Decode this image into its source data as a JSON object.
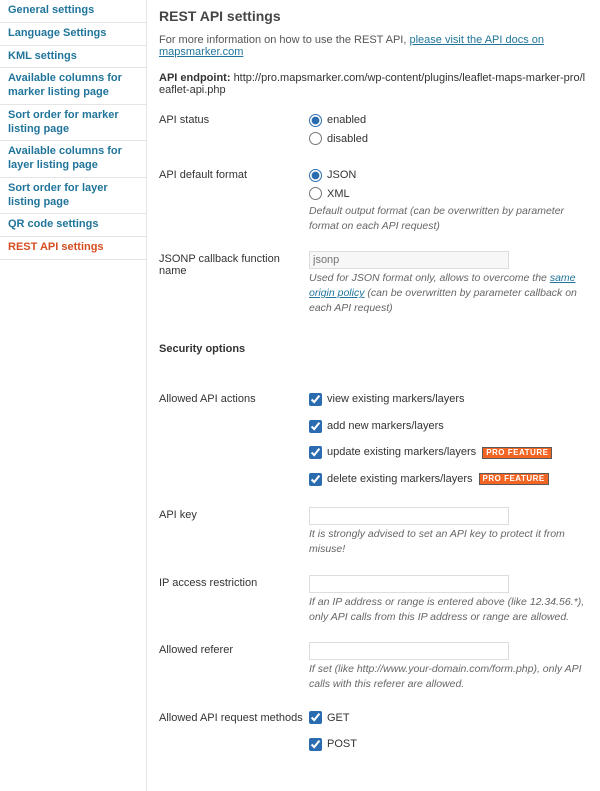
{
  "sidebar": {
    "items": [
      {
        "label": "General settings"
      },
      {
        "label": "Language Settings"
      },
      {
        "label": "KML settings"
      },
      {
        "label": "Available columns for marker listing page"
      },
      {
        "label": "Sort order for marker listing page"
      },
      {
        "label": "Available columns for layer listing page"
      },
      {
        "label": "Sort order for layer listing page"
      },
      {
        "label": "QR code settings"
      },
      {
        "label": "REST API settings"
      }
    ]
  },
  "page": {
    "title": "REST API settings",
    "intro_prefix": "For more information on how to use the REST API, ",
    "intro_link": "please visit the API docs on mapsmarker.com",
    "endpoint_label": "API endpoint:",
    "endpoint_value": "http://pro.mapsmarker.com/wp-content/plugins/leaflet-maps-marker-pro/leaflet-api.php"
  },
  "fields": {
    "api_status": {
      "label": "API status",
      "opts": [
        "enabled",
        "disabled"
      ],
      "selected": "enabled"
    },
    "default_format": {
      "label": "API default format",
      "opts": [
        "JSON",
        "XML"
      ],
      "selected": "JSON",
      "hint": "Default output format (can be overwritten by parameter format on each API request)"
    },
    "jsonp": {
      "label": "JSONP callback function name",
      "value": "",
      "placeholder": "jsonp",
      "hint_prefix": "Used for JSON format only, allows to overcome the ",
      "hint_link": "same origin policy",
      "hint_suffix": " (can be overwritten by parameter callback on each API request)"
    },
    "security_heading": "Security options",
    "allowed_actions": {
      "label": "Allowed API actions",
      "items": [
        {
          "text": "view existing markers/layers",
          "pro": false
        },
        {
          "text": "add new markers/layers",
          "pro": false
        },
        {
          "text": "update existing markers/layers",
          "pro": true
        },
        {
          "text": "delete existing markers/layers",
          "pro": true
        }
      ],
      "pro_badge": "PRO FEATURE"
    },
    "api_key": {
      "label": "API key",
      "value": "",
      "hint": "It is strongly advised to set an API key to protect it from misuse!"
    },
    "ip_restriction": {
      "label": "IP access restriction",
      "value": "",
      "hint": "If an IP address or range is entered above (like 12.34.56.*), only API calls from this IP address or range are allowed."
    },
    "allowed_referer": {
      "label": "Allowed referer",
      "value": "",
      "hint": "If set (like http://www.your-domain.com/form.php), only API calls with this referer are allowed."
    },
    "request_methods": {
      "label": "Allowed API request methods",
      "items": [
        "GET",
        "POST"
      ]
    }
  }
}
